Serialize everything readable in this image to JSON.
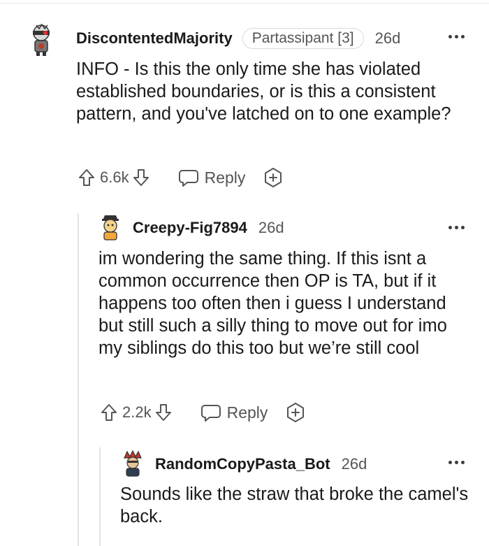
{
  "comments": [
    {
      "username": "DiscontentedMajority",
      "flair": "Partassipant [3]",
      "age": "26d",
      "body": "INFO - Is this the only time she has violated established boundaries, or is this a consistent pattern, and you've latched on to one example?",
      "score": "6.6k",
      "reply_label": "Reply"
    },
    {
      "username": "Creepy-Fig7894",
      "age": "26d",
      "body": "im wondering the same thing. If this isnt a common occurrence then OP is TA, but if it happens too often then i guess I understand but still such a silly thing to move out for imo my siblings do this too but we’re still cool",
      "score": "2.2k",
      "reply_label": "Reply"
    },
    {
      "username": "RandomCopyPasta_Bot",
      "age": "26d",
      "body": "Sounds like the straw that broke the camel's back."
    }
  ],
  "icons": {
    "upvote": "arrow-up-outline-icon",
    "downvote": "arrow-down-outline-icon",
    "reply": "speech-bubble-icon",
    "award": "award-plus-icon",
    "more": "more-dots-icon"
  },
  "colors": {
    "text": "#1a1a1b",
    "muted": "#555555",
    "thread_line": "#e1e3e5"
  }
}
